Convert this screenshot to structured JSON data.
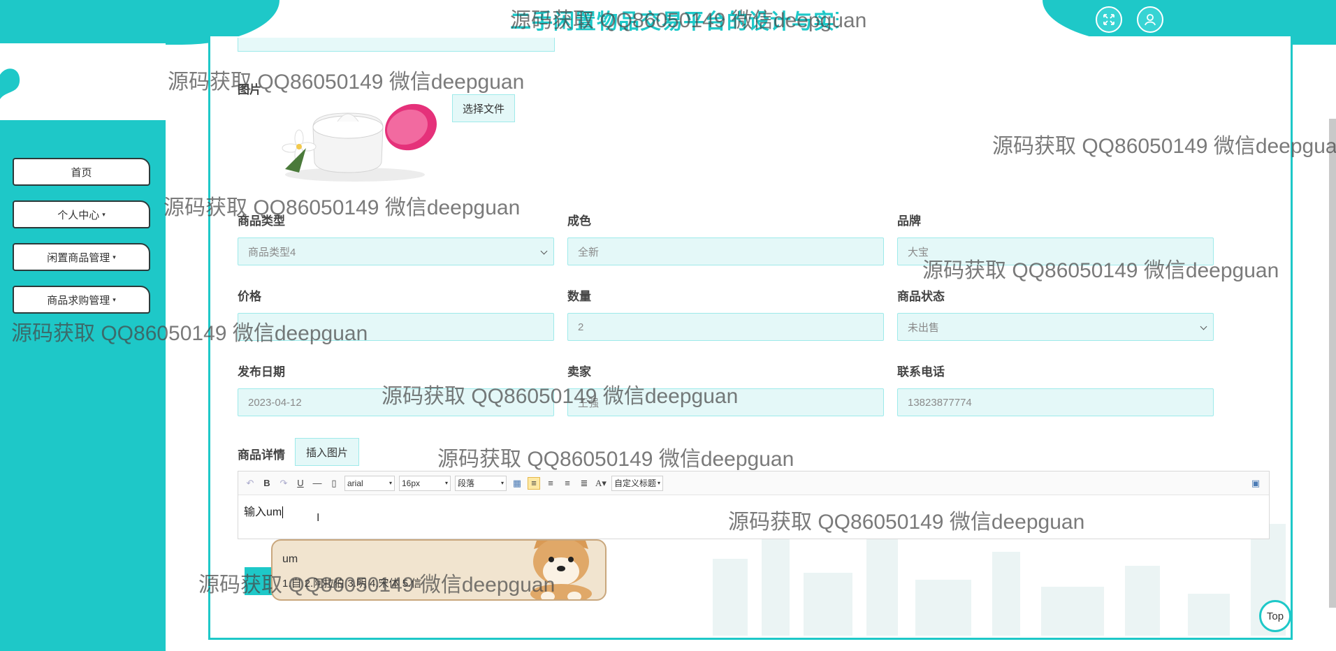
{
  "header": {
    "title": "二手闲置物品交易平台的设计与实现",
    "fullscreen_icon": "expand-arrows-icon",
    "user_icon": "user-icon"
  },
  "sidebar": {
    "items": [
      {
        "label": "首页",
        "caret": ""
      },
      {
        "label": "个人中心",
        "caret": "▾"
      },
      {
        "label": "闲置商品管理",
        "caret": "▾"
      },
      {
        "label": "商品求购管理",
        "caret": "▾"
      }
    ]
  },
  "form": {
    "image_label": "图片",
    "choose_file": "选择文件",
    "fields": [
      {
        "label": "商品类型",
        "value": "商品类型4"
      },
      {
        "label": "成色",
        "value": "全新"
      },
      {
        "label": "品牌",
        "value": "大宝"
      },
      {
        "label": "价格",
        "value": ""
      },
      {
        "label": "数量",
        "value": "2"
      },
      {
        "label": "商品状态",
        "value": "未出售"
      },
      {
        "label": "发布日期",
        "value": "2023-04-12"
      },
      {
        "label": "卖家",
        "value": "王强"
      },
      {
        "label": "联系电话",
        "value": "13823877774"
      }
    ],
    "detail_label": "商品详情",
    "insert_image": "插入图片"
  },
  "editor": {
    "font_family": "arial",
    "font_size": "16px",
    "paragraph": "段落",
    "custom_heading": "自定义标题",
    "content": "输入um"
  },
  "ime": {
    "composition": "um",
    "candidates": "1.自  2.阿拉伯  3.明  4.宋体  5.信"
  },
  "top_button": "Top",
  "watermark_text": "源码获取 QQ86050149 微信deepguan",
  "colors": {
    "accent": "#1ec8c8",
    "field_bg": "#e4f8f8"
  }
}
